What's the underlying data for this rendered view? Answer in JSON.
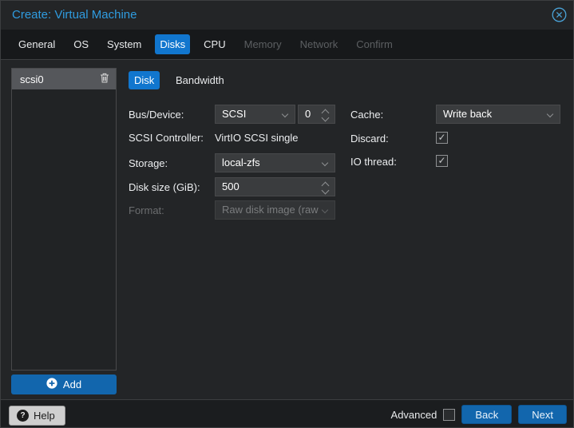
{
  "header": {
    "title": "Create: Virtual Machine"
  },
  "tabs": [
    {
      "label": "General",
      "state": "normal"
    },
    {
      "label": "OS",
      "state": "normal"
    },
    {
      "label": "System",
      "state": "normal"
    },
    {
      "label": "Disks",
      "state": "active"
    },
    {
      "label": "CPU",
      "state": "normal"
    },
    {
      "label": "Memory",
      "state": "disabled"
    },
    {
      "label": "Network",
      "state": "disabled"
    },
    {
      "label": "Confirm",
      "state": "disabled"
    }
  ],
  "sidebar": {
    "items": [
      {
        "label": "scsi0",
        "selected": true
      }
    ],
    "add_button": {
      "label": "Add"
    }
  },
  "content": {
    "subtabs": [
      {
        "label": "Disk",
        "state": "active"
      },
      {
        "label": "Bandwidth",
        "state": "normal"
      }
    ],
    "form": {
      "left": [
        {
          "label": "Bus/Device:",
          "combo_value": "SCSI",
          "spinner_value": "0"
        },
        {
          "label": "SCSI Controller:",
          "value": "VirtIO SCSI single"
        },
        {
          "label": "Storage:",
          "value": "local-zfs"
        },
        {
          "label": "Disk size (GiB):",
          "value": "500"
        },
        {
          "label": "Format:",
          "value": "Raw disk image (raw",
          "disabled": true
        }
      ],
      "right": [
        {
          "label": "Cache:",
          "value": "Write back"
        },
        {
          "label": "Discard:",
          "checked": true,
          "glyph": "✓"
        },
        {
          "label": "IO thread:",
          "checked": true,
          "glyph": "✓"
        }
      ]
    }
  },
  "footer": {
    "help_button": {
      "label": "Help"
    },
    "advanced": {
      "label": "Advanced",
      "checked": false,
      "glyph": ""
    },
    "back_button": "Back",
    "next_button": "Next"
  },
  "colors": {
    "title_blue": "#2f9ce0",
    "active_tab_blue": "#1176ce",
    "button_blue": "#1266ad",
    "selected_row_gray": "#55575b"
  }
}
